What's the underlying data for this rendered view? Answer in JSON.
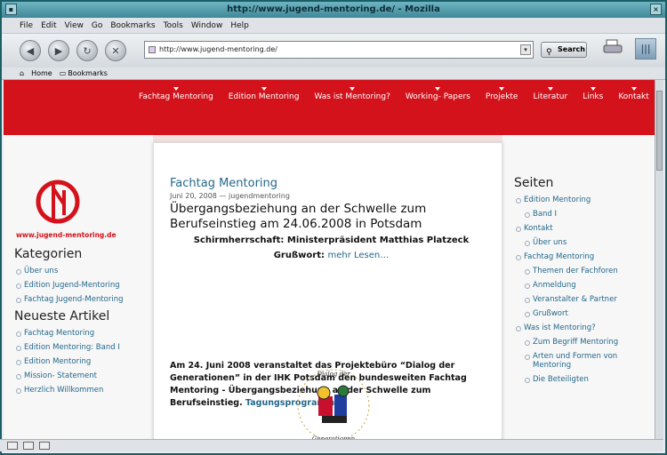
{
  "browser": {
    "title": "http://www.jugend-mentoring.de/ - Mozilla",
    "menu": [
      "File",
      "Edit",
      "View",
      "Go",
      "Bookmarks",
      "Tools",
      "Window",
      "Help"
    ],
    "url": "http://www.jugend-mentoring.de/",
    "search_label": "Search",
    "bookmarks": [
      "Home",
      "Bookmarks"
    ]
  },
  "site": {
    "nav": [
      "Fachtag Mentoring",
      "Edition Mentoring",
      "Was ist Mentoring?",
      "Working- Papers",
      "Projekte",
      "Literatur",
      "Links",
      "Kontakt"
    ],
    "logo_url": "www.jugend-mentoring.de",
    "left": {
      "kategorien_title": "Kategorien",
      "kategorien": [
        "Über uns",
        "Edition Jugend-Mentoring",
        "Fachtag Jugend-Mentoring"
      ],
      "neueste_title": "Neueste Artikel",
      "neueste": [
        "Fachtag Mentoring",
        "Edition Mentoring: Band I",
        "Edition Mentoring",
        "Mission- Statement",
        "Herzlich Willkommen"
      ]
    },
    "post": {
      "title": "Fachtag Mentoring",
      "meta": "Juni 20, 2008 — jugendmentoring",
      "heading": "Übergangsbeziehung an der Schwelle zum Berufseinstieg am 24.06.2008 in Potsdam",
      "schirm": "Schirmherrschaft: Ministerpräsident Matthias Platzeck",
      "gruss": "Grußwort:",
      "mehr": "mehr Lesen…",
      "body": "Am 24. Juni 2008 veranstaltet das Projektebüro “Dialog der Generationen” in der IHK Potsdam den bundesweiten Fachtag Mentoring - Übergangsbeziehung an der Schwelle zum Berufseinstieg.",
      "body_link": "Tagungsprogramm",
      "emblem_text": "Dialog der Generationen"
    },
    "right": {
      "title": "Seiten",
      "items": [
        {
          "label": "Edition Mentoring",
          "sub": false
        },
        {
          "label": "Band I",
          "sub": true
        },
        {
          "label": "Kontakt",
          "sub": false
        },
        {
          "label": "Über uns",
          "sub": true
        },
        {
          "label": "Fachtag Mentoring",
          "sub": false
        },
        {
          "label": "Themen der Fachforen",
          "sub": true
        },
        {
          "label": "Anmeldung",
          "sub": true
        },
        {
          "label": "Veranstalter & Partner",
          "sub": true
        },
        {
          "label": "Grußwort",
          "sub": true
        },
        {
          "label": "Was ist Mentoring?",
          "sub": false
        },
        {
          "label": "Zum Begriff Mentoring",
          "sub": true
        },
        {
          "label": "Arten und Formen von Mentoring",
          "sub": true
        },
        {
          "label": "Die Beteiligten",
          "sub": true
        }
      ]
    }
  },
  "colors": {
    "brand_red": "#d4121b",
    "link": "#24688c",
    "desktop": "#2e8a90"
  }
}
